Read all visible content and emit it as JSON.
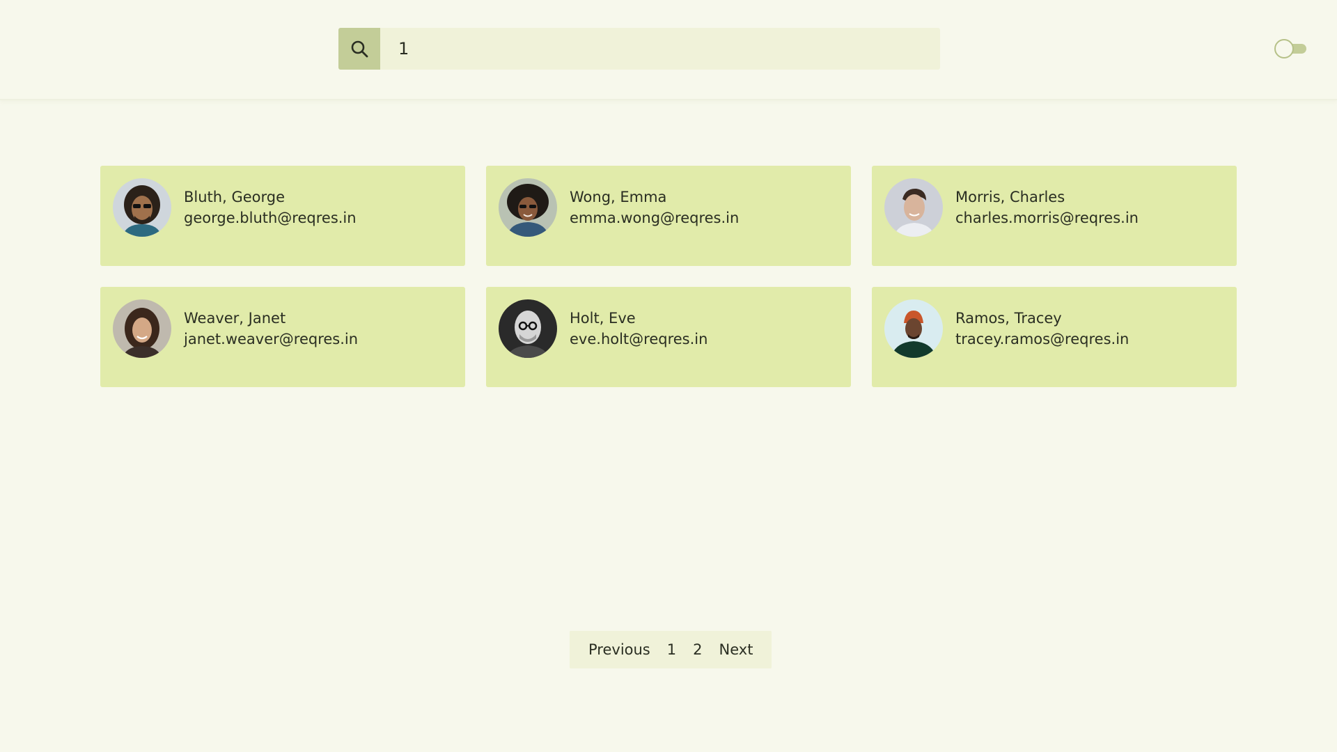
{
  "search": {
    "value": "1",
    "icon": "search-icon"
  },
  "theme_toggle": {
    "state": "off"
  },
  "users": [
    {
      "name": "Bluth, George",
      "email": "george.bluth@reqres.in"
    },
    {
      "name": "Wong, Emma",
      "email": "emma.wong@reqres.in"
    },
    {
      "name": "Morris, Charles",
      "email": "charles.morris@reqres.in"
    },
    {
      "name": "Weaver, Janet",
      "email": "janet.weaver@reqres.in"
    },
    {
      "name": "Holt, Eve",
      "email": "eve.holt@reqres.in"
    },
    {
      "name": "Ramos, Tracey",
      "email": "tracey.ramos@reqres.in"
    }
  ],
  "pagination": {
    "previous": "Previous",
    "pages": [
      "1",
      "2"
    ],
    "next": "Next"
  },
  "colors": {
    "background": "#f7f8ec",
    "card": "#e1ebaa",
    "accent": "#c3cd98",
    "search_field": "#f0f2d9"
  }
}
